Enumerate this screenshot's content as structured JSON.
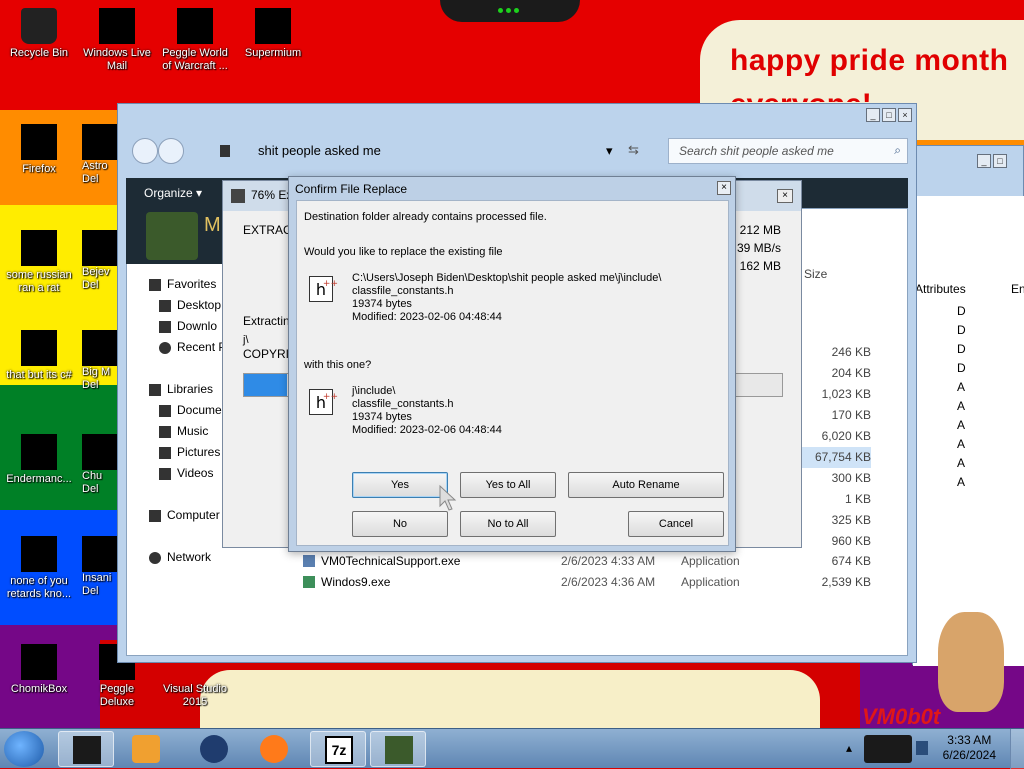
{
  "wallpaper": {
    "headline": "happy pride month",
    "headline_line2": "everyone!",
    "watermark": "VM0b0t"
  },
  "desktop_icons": [
    {
      "label": "Recycle Bin"
    },
    {
      "label": "Windows Live Mail"
    },
    {
      "label": "Peggle World of Warcraft ..."
    },
    {
      "label": "Supermium"
    },
    {
      "label": "Firefox"
    },
    {
      "label": "Astro Del"
    },
    {
      "label": "some russian ran a rat"
    },
    {
      "label": "Bejev Del"
    },
    {
      "label": "that but its c#"
    },
    {
      "label": "Big M Del"
    },
    {
      "label": "Endermanc..."
    },
    {
      "label": "Chu Del"
    },
    {
      "label": "none of you retards kno..."
    },
    {
      "label": "Insani Del"
    },
    {
      "label": "ChomikBox"
    },
    {
      "label": "Peggle Deluxe"
    },
    {
      "label": "Visual Studio 2015"
    }
  ],
  "explorer": {
    "address": "shit people asked me",
    "search_placeholder": "Search shit people asked me",
    "organize": "Organize",
    "nav": [
      {
        "label": "Favorites"
      },
      {
        "label": "Desktop"
      },
      {
        "label": "Downlo"
      },
      {
        "label": "Recent P"
      },
      {
        "label": "Libraries"
      },
      {
        "label": "Docume"
      },
      {
        "label": "Music"
      },
      {
        "label": "Pictures"
      },
      {
        "label": "Videos"
      },
      {
        "label": "Computer"
      },
      {
        "label": "Network"
      }
    ],
    "size_header": "Size",
    "sizes": [
      "246 KB",
      "204 KB",
      "1,023 KB",
      "170 KB",
      "6,020 KB",
      "67,754 KB",
      "300 KB",
      "1 KB",
      "325 KB",
      "960 KB"
    ],
    "files": [
      {
        "name": "VM0TechnicalSupport.exe",
        "date": "2/6/2023 4:33 AM",
        "type": "Application",
        "size": "674 KB"
      },
      {
        "name": "Windos9.exe",
        "date": "2/6/2023 4:36 AM",
        "type": "Application",
        "size": "2,539 KB"
      }
    ]
  },
  "explorer2": {
    "attributes_header": "Attributes",
    "en_header": "En",
    "attrs": [
      "D",
      "D",
      "D",
      "D",
      "A",
      "A",
      "A",
      "A",
      "A",
      "A"
    ]
  },
  "extract": {
    "title": "76% Ex",
    "title_letter": "M",
    "label_extract": "EXTRACT",
    "label_extracting": "Extracting",
    "path_fragment": "j\\",
    "copyright": "COPYRIG",
    "stats": [
      "212 MB",
      "39 MB/s",
      "162 MB"
    ],
    "progress": 0.08
  },
  "confirm": {
    "title": "Confirm File Replace",
    "msg1": "Destination folder already contains processed file.",
    "msg2": "Would you like to replace the existing file",
    "existing": {
      "path": "C:\\Users\\Joseph Biden\\Desktop\\shit people asked me\\j\\include\\",
      "name": "classfile_constants.h",
      "size": "19374 bytes",
      "modified": "Modified: 2023-02-06 04:48:44"
    },
    "with_label": "with this one?",
    "incoming": {
      "path": "j\\include\\",
      "name": "classfile_constants.h",
      "size": "19374 bytes",
      "modified": "Modified: 2023-02-06 04:48:44"
    },
    "buttons": {
      "yes": "Yes",
      "yes_all": "Yes to All",
      "auto_rename": "Auto Rename",
      "no": "No",
      "no_all": "No to All",
      "cancel": "Cancel"
    }
  },
  "taskbar": {
    "time": "3:33 AM",
    "date": "6/26/2024",
    "apps": [
      "terminal",
      "media-player",
      "supermium",
      "firefox",
      "7zip",
      "minecraft"
    ]
  },
  "colors": {
    "accent": "#2f8be6",
    "dialog_frame": "#bdd0e6"
  }
}
